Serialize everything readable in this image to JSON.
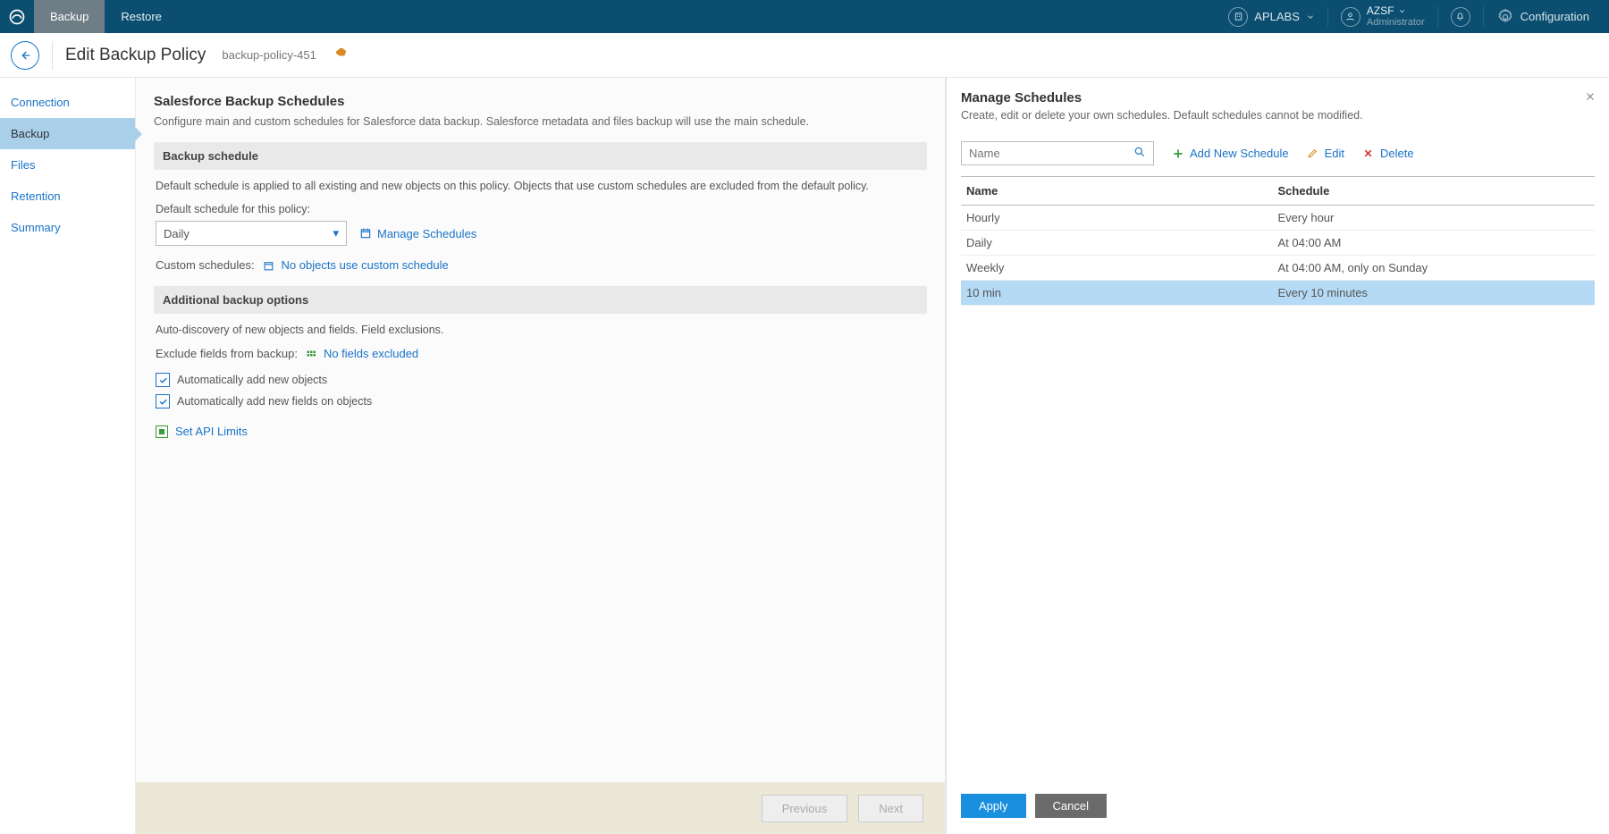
{
  "topbar": {
    "tabs": {
      "backup": "Backup",
      "restore": "Restore"
    },
    "org": "APLABS",
    "user": "AZSF",
    "user_role": "Administrator",
    "config": "Configuration"
  },
  "title": {
    "heading": "Edit Backup Policy",
    "subtitle": "backup-policy-451"
  },
  "sidebar": {
    "connection": "Connection",
    "backup": "Backup",
    "files": "Files",
    "retention": "Retention",
    "summary": "Summary"
  },
  "main": {
    "heading": "Salesforce Backup Schedules",
    "desc": "Configure main and custom schedules for Salesforce data backup. Salesforce metadata and files backup will use the main schedule.",
    "section1": {
      "title": "Backup schedule",
      "note": "Default schedule is applied to all existing and new objects on this policy. Objects that use custom schedules are excluded from the default policy.",
      "label": "Default schedule for this policy:",
      "selected": "Daily",
      "manage": "Manage Schedules",
      "custom_label": "Custom schedules:",
      "custom_link": "No objects use custom schedule"
    },
    "section2": {
      "title": "Additional backup options",
      "note": "Auto-discovery of new objects and fields. Field exclusions.",
      "exclude_label": "Exclude fields from backup:",
      "exclude_link": "No fields excluded",
      "chk1": "Automatically add new objects",
      "chk2": "Automatically add new fields on objects",
      "api": "Set API Limits"
    },
    "footer": {
      "prev": "Previous",
      "next": "Next"
    }
  },
  "panel": {
    "heading": "Manage Schedules",
    "desc": "Create, edit or delete your own schedules. Default schedules cannot be modified.",
    "search_placeholder": "Name",
    "add": "Add New Schedule",
    "edit": "Edit",
    "delete": "Delete",
    "col_name": "Name",
    "col_schedule": "Schedule",
    "rows": [
      {
        "name": "Hourly",
        "schedule": "Every hour"
      },
      {
        "name": "Daily",
        "schedule": "At 04:00 AM"
      },
      {
        "name": "Weekly",
        "schedule": "At 04:00 AM, only on Sunday"
      },
      {
        "name": "10 min",
        "schedule": "Every 10 minutes"
      }
    ],
    "apply": "Apply",
    "cancel": "Cancel"
  }
}
